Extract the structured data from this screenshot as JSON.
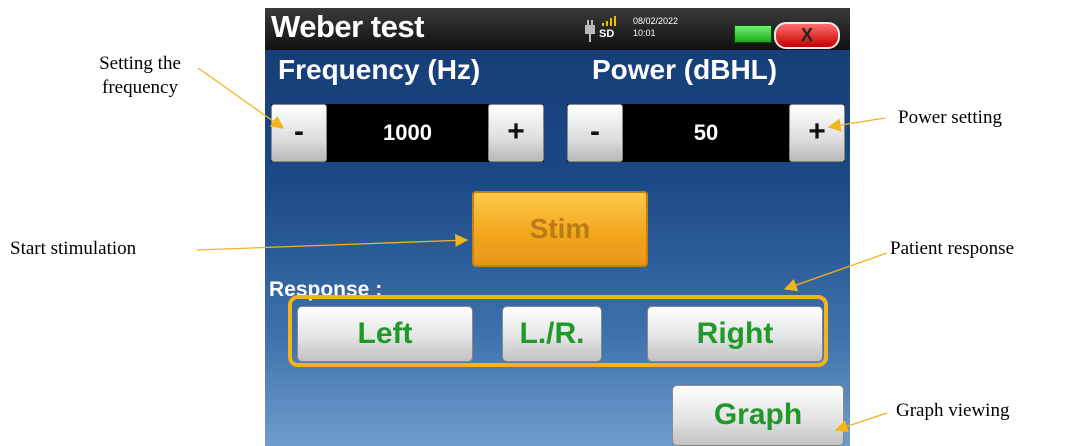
{
  "annotations": {
    "frequency": [
      "Setting the",
      "frequency"
    ],
    "stimulation": "Start stimulation",
    "power": "Power setting",
    "response": "Patient response",
    "graph": "Graph viewing"
  },
  "titlebar": {
    "title": "Weber test",
    "storage_label": "SD",
    "date": "08/02/2022",
    "time": "10:01",
    "close_label": "X",
    "icons": [
      "plug-icon",
      "signal-icon",
      "battery-icon",
      "close-icon"
    ]
  },
  "frequency": {
    "label": "Frequency (Hz)",
    "decrement": "-",
    "value": "1000",
    "increment": "+"
  },
  "power": {
    "label": "Power (dBHL)",
    "decrement": "-",
    "value": "50",
    "increment": "+"
  },
  "stim_label": "Stim",
  "response": {
    "label": "Response :",
    "left": "Left",
    "left_right": "L./R.",
    "right": "Right"
  },
  "graph_label": "Graph",
  "colors": {
    "accent_orange": "#f5b31a",
    "response_text_green": "#1f9a2a",
    "battery_green": "#2ecc2e",
    "close_red": "#d90000"
  }
}
